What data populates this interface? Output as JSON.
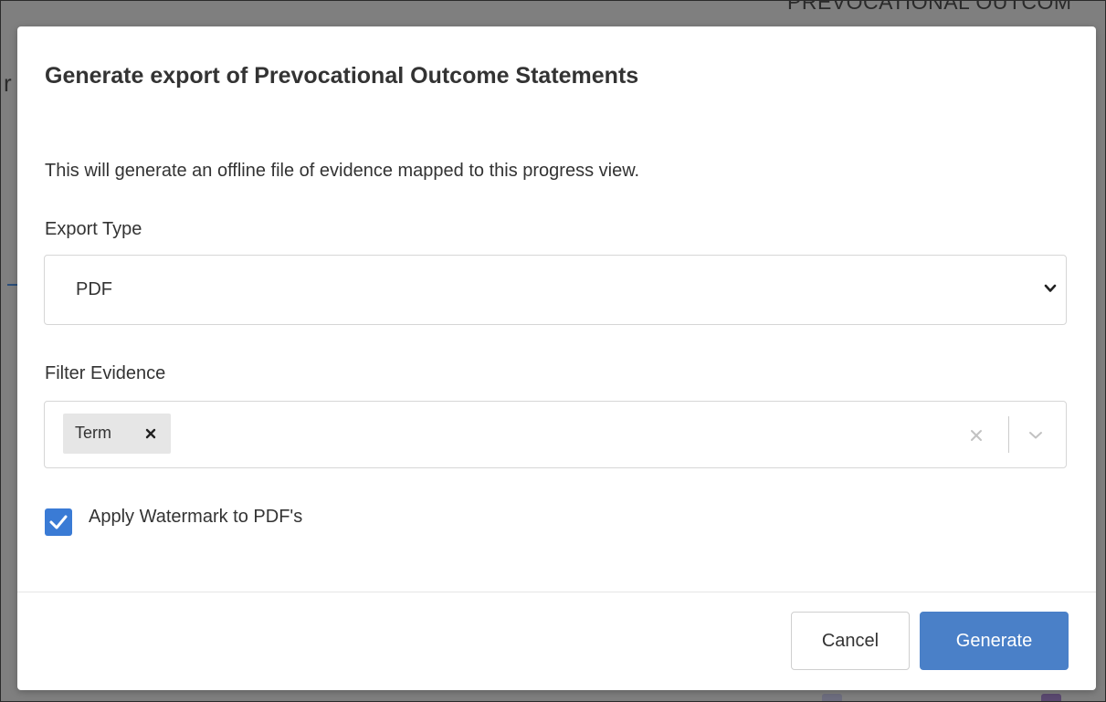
{
  "background": {
    "header_fragment": "PREVOCATIONAL OUTCOM",
    "left_fragment": "r"
  },
  "dialog": {
    "title": "Generate export of Prevocational Outcome Statements",
    "description": "This will generate an offline file of evidence mapped to this progress view.",
    "export_type": {
      "label": "Export Type",
      "selected": "PDF",
      "icon": "chevron-down-icon"
    },
    "filter_evidence": {
      "label": "Filter Evidence",
      "tags": [
        {
          "label": "Term",
          "remove_icon": "close-icon"
        }
      ],
      "clear_icon": "close-icon",
      "dropdown_icon": "chevron-down-icon"
    },
    "watermark": {
      "label": "Apply Watermark to PDF's",
      "checked": true
    },
    "buttons": {
      "cancel": "Cancel",
      "generate": "Generate"
    }
  },
  "colors": {
    "primary": "#4a80c8",
    "checkbox": "#3a7bd5",
    "overlay": "#7f7f7f",
    "text": "#333333"
  }
}
